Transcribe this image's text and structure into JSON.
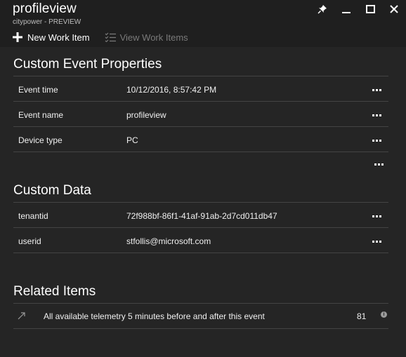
{
  "header": {
    "title": "profileview",
    "subtitle": "citypower - PREVIEW",
    "controls": [
      "pin-icon",
      "minimize-icon",
      "maximize-icon",
      "close-icon"
    ]
  },
  "commands": {
    "new_work_item": "New Work Item",
    "view_work_items": "View Work Items"
  },
  "custom_event_properties": {
    "title": "Custom Event Properties",
    "rows": [
      {
        "key": "Event time",
        "value": "10/12/2016, 8:57:42 PM"
      },
      {
        "key": "Event name",
        "value": "profileview"
      },
      {
        "key": "Device type",
        "value": "PC"
      }
    ]
  },
  "custom_data": {
    "title": "Custom Data",
    "rows": [
      {
        "key": "tenantid",
        "value": "72f988bf-86f1-41af-91ab-2d7cd011db47"
      },
      {
        "key": "userid",
        "value": "stfollis@microsoft.com"
      }
    ]
  },
  "related_items": {
    "title": "Related Items",
    "items": [
      {
        "label": "All available telemetry 5 minutes before and after this event",
        "count": "81",
        "info": "i"
      }
    ]
  }
}
